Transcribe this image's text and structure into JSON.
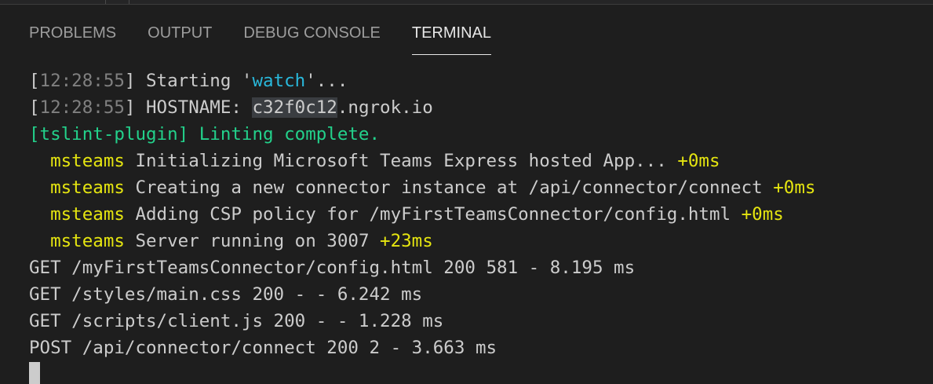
{
  "tabs": [
    {
      "label": "PROBLEMS"
    },
    {
      "label": "OUTPUT"
    },
    {
      "label": "DEBUG CONSOLE"
    },
    {
      "label": "TERMINAL"
    }
  ],
  "active_tab": "TERMINAL",
  "terminal": {
    "line1": {
      "ts": "12:28:55",
      "text": " Starting '",
      "task": "watch",
      "after": "'..."
    },
    "line2": {
      "ts": "12:28:55",
      "label": " HOSTNAME: ",
      "selected": "c32f0c12",
      "rest": ".ngrok.io"
    },
    "line3": {
      "text": "[tslint-plugin] Linting complete."
    },
    "log": [
      {
        "tag": "msteams",
        "message": "Initializing Microsoft Teams Express hosted App...",
        "delta": "+0ms"
      },
      {
        "tag": "msteams",
        "message": "Creating a new connector instance at /api/connector/connect",
        "delta": "+0ms"
      },
      {
        "tag": "msteams",
        "message": "Adding CSP policy for /myFirstTeamsConnector/config.html",
        "delta": "+0ms"
      },
      {
        "tag": "msteams",
        "message": "Server running on 3007",
        "delta": "+23ms"
      }
    ],
    "requests": [
      "GET /myFirstTeamsConnector/config.html 200 581 - 8.195 ms",
      "GET /styles/main.css 200 - - 6.242 ms",
      "GET /scripts/client.js 200 - - 1.228 ms",
      "POST /api/connector/connect 200 2 - 3.663 ms"
    ]
  },
  "colors": {
    "background": "#1e1e1e",
    "timestamp": "#808080",
    "task": "#29b8db",
    "lint": "#23d18b",
    "namespace": "#e5e510",
    "text": "#cccccc"
  }
}
